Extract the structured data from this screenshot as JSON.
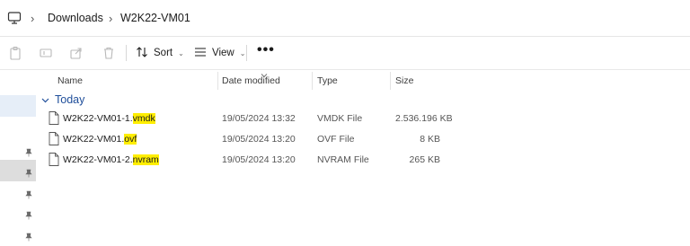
{
  "breadcrumb": {
    "items": [
      "Downloads",
      "W2K22-VM01"
    ]
  },
  "toolbar": {
    "sort_label": "Sort",
    "view_label": "View",
    "more_label": "•••"
  },
  "columns": {
    "name": "Name",
    "date_modified": "Date modified",
    "type": "Type",
    "size": "Size"
  },
  "group": {
    "label": "Today"
  },
  "files": [
    {
      "name_base": "W2K22-VM01-1.",
      "name_ext": "vmdk",
      "date": "19/05/2024 13:32",
      "type": "VMDK File",
      "size": "2.536.196 KB"
    },
    {
      "name_base": "W2K22-VM01.",
      "name_ext": "ovf",
      "date": "19/05/2024 13:20",
      "type": "OVF File",
      "size": "8 KB"
    },
    {
      "name_base": "W2K22-VM01-2.",
      "name_ext": "nvram",
      "date": "19/05/2024 13:20",
      "type": "NVRAM File",
      "size": "265 KB"
    }
  ],
  "colors": {
    "highlight": "#ffee00",
    "group_text": "#1f4e9a",
    "nav_selected": "#e6eef8"
  }
}
